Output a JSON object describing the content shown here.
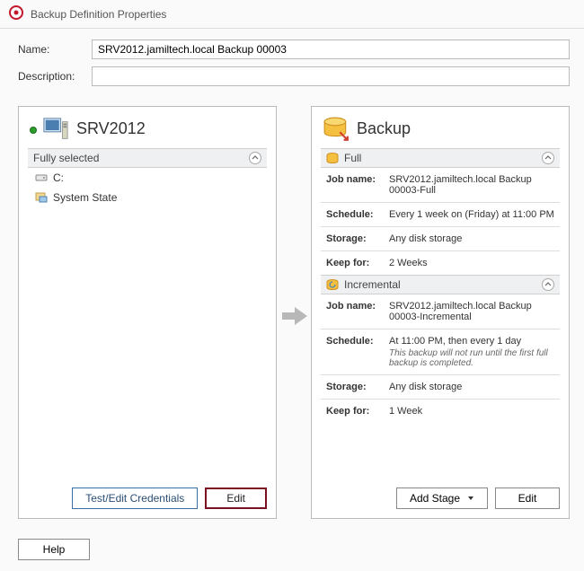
{
  "title": "Backup Definition Properties",
  "form": {
    "name_label": "Name:",
    "name_value": "SRV2012.jamiltech.local Backup 00003",
    "desc_label": "Description:",
    "desc_value": ""
  },
  "leftPanel": {
    "header": "SRV2012",
    "section": "Fully selected",
    "items": [
      {
        "label": "C:"
      },
      {
        "label": "System State"
      }
    ],
    "btn_test": "Test/Edit Credentials",
    "btn_edit": "Edit"
  },
  "rightPanel": {
    "header": "Backup",
    "full": {
      "title": "Full",
      "jobname_label": "Job name:",
      "jobname_value": "SRV2012.jamiltech.local Backup 00003-Full",
      "schedule_label": "Schedule:",
      "schedule_value": "Every 1 week on (Friday) at 11:00 PM",
      "storage_label": "Storage:",
      "storage_value": "Any disk storage",
      "keep_label": "Keep for:",
      "keep_value": "2 Weeks"
    },
    "incr": {
      "title": "Incremental",
      "jobname_label": "Job name:",
      "jobname_value": "SRV2012.jamiltech.local Backup 00003-Incremental",
      "schedule_label": "Schedule:",
      "schedule_value": "At 11:00 PM, then every 1 day",
      "schedule_note": "This backup will not run until the first full backup is completed.",
      "storage_label": "Storage:",
      "storage_value": "Any disk storage",
      "keep_label": "Keep for:",
      "keep_value": "1 Week"
    },
    "btn_addstage": "Add Stage",
    "btn_edit": "Edit"
  },
  "footer": {
    "help": "Help"
  }
}
